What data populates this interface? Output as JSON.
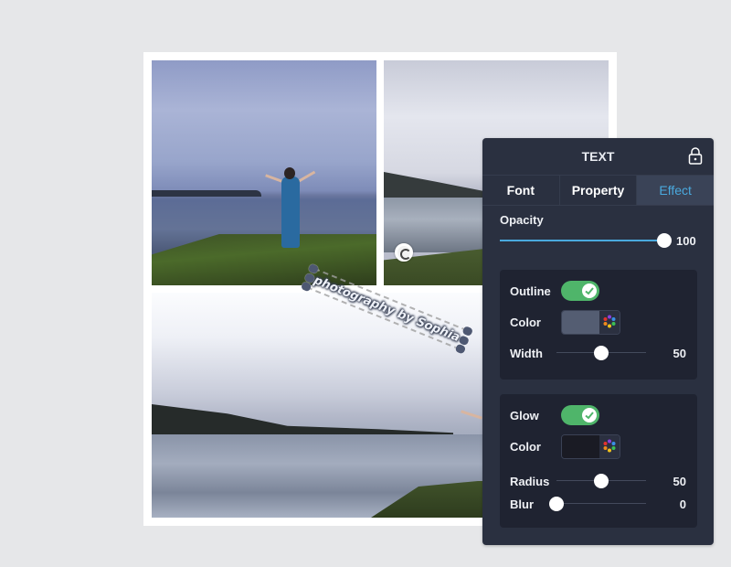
{
  "watermark": {
    "text": "photography by Sophia"
  },
  "panel": {
    "title": "TEXT",
    "lock_icon": "lock-icon",
    "tabs": [
      {
        "label": "Font",
        "active": false
      },
      {
        "label": "Property",
        "active": false
      },
      {
        "label": "Effect",
        "active": true
      }
    ],
    "opacity": {
      "label": "Opacity",
      "value": "100",
      "fraction": 1.0
    },
    "outline": {
      "label": "Outline",
      "enabled": true,
      "color_label": "Color",
      "color": "#545d72",
      "width_label": "Width",
      "width_value": "50",
      "width_fraction": 0.5
    },
    "glow": {
      "label": "Glow",
      "enabled": true,
      "color_label": "Color",
      "color": "#1a1b24",
      "radius_label": "Radius",
      "radius_value": "50",
      "radius_fraction": 0.5,
      "blur_label": "Blur",
      "blur_value": "0",
      "blur_fraction": 0.0
    }
  },
  "colors": {
    "accent": "#4aa9de",
    "toggle_on": "#4fb56a",
    "panel_bg": "#2a3040",
    "group_bg": "#1f2331"
  }
}
